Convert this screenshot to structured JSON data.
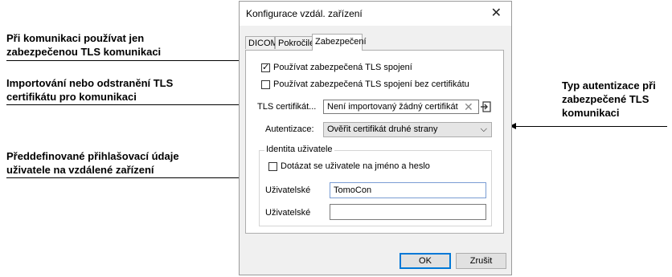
{
  "annotations": {
    "tls_only": [
      "Při komunikaci používat jen",
      "zabezpečenou TLS komunikaci"
    ],
    "cert_import": [
      "Importování nebo odstranění TLS",
      "certifikátu pro komunikaci"
    ],
    "auth_type": [
      "Typ autentizace při",
      "zabezpečené TLS",
      "komunikaci"
    ],
    "credentials": [
      "Předdefinované přihlašovací údaje",
      "uživatele na vzdálené zařízení"
    ]
  },
  "dialog": {
    "title": "Konfigurace vzdál. zařízení",
    "close_glyph": "✕",
    "tabs": [
      "DICOM",
      "Pokročilé",
      "Zabezpečení"
    ],
    "active_tab": "Zabezpečení",
    "use_tls_label": "Používat zabezpečená TLS spojení",
    "use_tls_checked": true,
    "use_tls_no_cert_label": "Používat zabezpečená TLS spojení bez certifikátu",
    "use_tls_no_cert_checked": false,
    "tls_cert_label": "TLS certifikát...",
    "tls_cert_value": "Není importovaný žádný certifikát",
    "auth_label": "Autentizace:",
    "auth_value": "Ověřit certifikát druhé strany",
    "identity_group": "Identita uživatele",
    "ask_user_label": "Dotázat se uživatele na jméno a heslo",
    "ask_user_checked": false,
    "user_label": "Uživatelské",
    "user_value": "TomoCon",
    "pass_label": "Uživatelské",
    "pass_value": "",
    "ok_label": "OK",
    "cancel_label": "Zrušit"
  }
}
